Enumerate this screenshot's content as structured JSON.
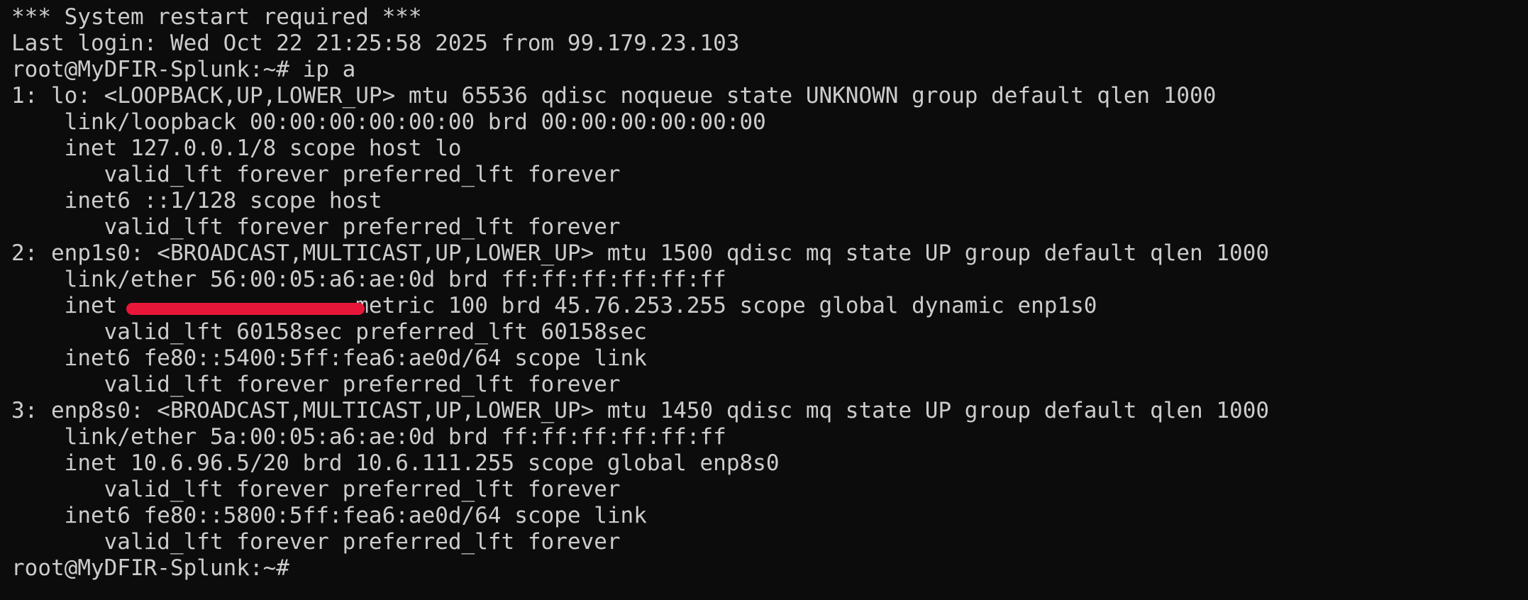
{
  "theme": {
    "background": "#0c0c0c",
    "foreground": "#cccccc",
    "redaction_color": "#e8173a"
  },
  "terminal": {
    "lines": [
      "*** System restart required ***",
      "Last login: Wed Oct 22 21:25:58 2025 from 99.179.23.103",
      "root@MyDFIR-Splunk:~# ip a",
      "1: lo: <LOOPBACK,UP,LOWER_UP> mtu 65536 qdisc noqueue state UNKNOWN group default qlen 1000",
      "    link/loopback 00:00:00:00:00:00 brd 00:00:00:00:00:00",
      "    inet 127.0.0.1/8 scope host lo",
      "       valid_lft forever preferred_lft forever",
      "    inet6 ::1/128 scope host",
      "       valid_lft forever preferred_lft forever",
      "2: enp1s0: <BROADCAST,MULTICAST,UP,LOWER_UP> mtu 1500 qdisc mq state UP group default qlen 1000",
      "    link/ether 56:00:05:a6:ae:0d brd ff:ff:ff:ff:ff:ff"
    ],
    "redacted_line": {
      "prefix": "    inet ",
      "hidden": "                ",
      "suffix": " metric 100 brd 45.76.253.255 scope global dynamic enp1s0"
    },
    "lines_after": [
      "       valid_lft 60158sec preferred_lft 60158sec",
      "    inet6 fe80::5400:5ff:fea6:ae0d/64 scope link",
      "       valid_lft forever preferred_lft forever",
      "3: enp8s0: <BROADCAST,MULTICAST,UP,LOWER_UP> mtu 1450 qdisc mq state UP group default qlen 1000",
      "    link/ether 5a:00:05:a6:ae:0d brd ff:ff:ff:ff:ff:ff",
      "    inet 10.6.96.5/20 brd 10.6.111.255 scope global enp8s0",
      "       valid_lft forever preferred_lft forever",
      "    inet6 fe80::5800:5ff:fea6:ae0d/64 scope link",
      "       valid_lft forever preferred_lft forever",
      "root@MyDFIR-Splunk:~# "
    ]
  }
}
